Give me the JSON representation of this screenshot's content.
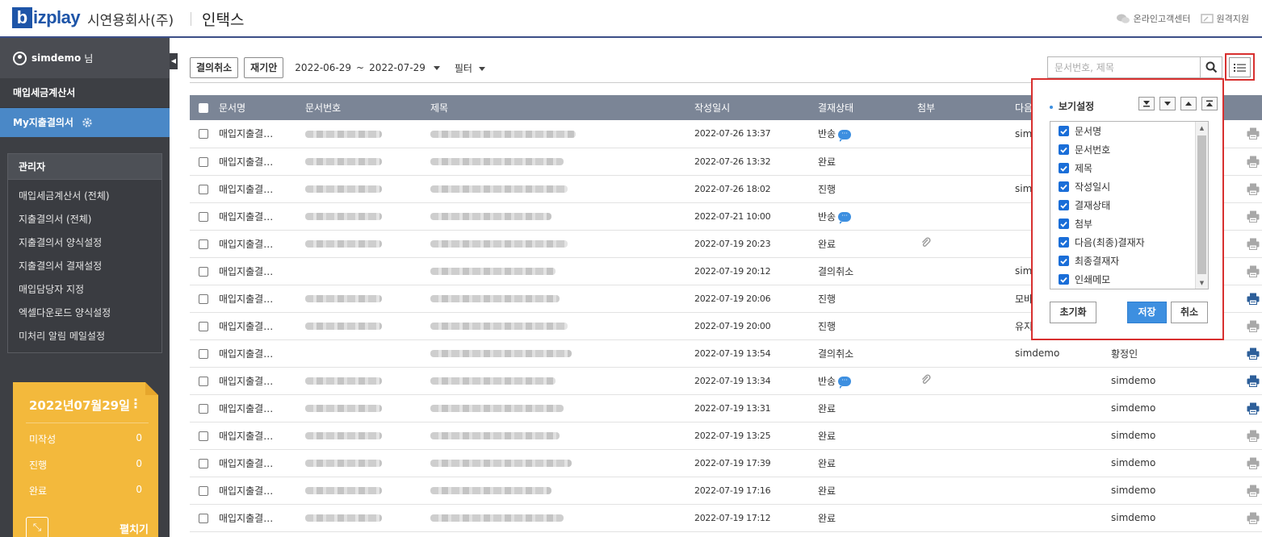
{
  "header": {
    "logo_letter": "b",
    "logo_text": "izplay",
    "company": "시연용회사(주)",
    "title": "인택스",
    "links": [
      {
        "icon": "chat-bubbles-icon",
        "label": "온라인고객센터"
      },
      {
        "icon": "remote-support-icon",
        "label": "원격지원"
      }
    ]
  },
  "sidebar": {
    "user": {
      "name": "simdemo",
      "suffix": "님"
    },
    "menu": [
      {
        "label": "매입세금계산서",
        "active": false
      },
      {
        "label": "My지출결의서",
        "active": true
      }
    ],
    "admin": {
      "title": "관리자",
      "items": [
        "매입세금계산서 (전체)",
        "지출결의서 (전체)",
        "지출결의서 양식설정",
        "지출결의서 결재설정",
        "매입담당자 지정",
        "엑셀다운로드 양식설정",
        "미처리 알림 메일설정"
      ]
    },
    "calendar": {
      "date": "2022년07월29일",
      "stats": [
        {
          "label": "미작성",
          "value": "0"
        },
        {
          "label": "진행",
          "value": "0"
        },
        {
          "label": "완료",
          "value": "0"
        }
      ],
      "expand_label": "펼치기"
    }
  },
  "toolbar": {
    "cancel_label": "결의취소",
    "redraft_label": "재기안",
    "date_from": "2022-06-29",
    "tilde": "~",
    "date_to": "2022-07-29",
    "filter_label": "필터",
    "search_placeholder": "문서번호, 제목"
  },
  "table": {
    "columns": [
      "문서명",
      "문서번호",
      "제목",
      "작성일시",
      "결재상태",
      "첨부",
      "다음"
    ],
    "rows": [
      {
        "name": "매입지출결…",
        "docno": true,
        "subject": 180,
        "date": "2022-07-26 13:37",
        "status": "반송",
        "memo": true,
        "attach": false,
        "next": "sim",
        "final": "",
        "print": "light"
      },
      {
        "name": "매입지출결…",
        "docno": true,
        "subject": 165,
        "date": "2022-07-26 13:32",
        "status": "완료",
        "memo": false,
        "attach": false,
        "next": "",
        "final": "",
        "print": "light"
      },
      {
        "name": "매입지출결…",
        "docno": true,
        "subject": 170,
        "date": "2022-07-26 18:02",
        "status": "진행",
        "memo": false,
        "attach": false,
        "next": "sim",
        "final": "",
        "print": "light"
      },
      {
        "name": "매입지출결…",
        "docno": true,
        "subject": 150,
        "date": "2022-07-21 10:00",
        "status": "반송",
        "memo": true,
        "attach": false,
        "next": "",
        "final": "",
        "print": "light"
      },
      {
        "name": "매입지출결…",
        "docno": true,
        "subject": 170,
        "date": "2022-07-19 20:23",
        "status": "완료",
        "memo": false,
        "attach": true,
        "next": "",
        "final": "",
        "print": "light"
      },
      {
        "name": "매입지출결…",
        "docno": false,
        "subject": 155,
        "date": "2022-07-19 20:12",
        "status": "결의취소",
        "memo": false,
        "attach": false,
        "next": "sim",
        "final": "",
        "print": "light"
      },
      {
        "name": "매입지출결…",
        "docno": true,
        "subject": 160,
        "date": "2022-07-19 20:06",
        "status": "진행",
        "memo": false,
        "attach": false,
        "next": "모바",
        "final": "",
        "print": "dark"
      },
      {
        "name": "매입지출결…",
        "docno": true,
        "subject": 170,
        "date": "2022-07-19 20:00",
        "status": "진행",
        "memo": false,
        "attach": false,
        "next": "유지",
        "final": "",
        "print": "light"
      },
      {
        "name": "매입지출결…",
        "docno": false,
        "subject": 175,
        "date": "2022-07-19 13:54",
        "status": "결의취소",
        "memo": false,
        "attach": false,
        "next": "simdemo",
        "final": "황정인",
        "print": "dark"
      },
      {
        "name": "매입지출결…",
        "docno": true,
        "subject": 155,
        "date": "2022-07-19 13:34",
        "status": "반송",
        "memo": true,
        "attach": true,
        "next": "",
        "final": "simdemo",
        "print": "dark"
      },
      {
        "name": "매입지출결…",
        "docno": true,
        "subject": 165,
        "date": "2022-07-19 13:31",
        "status": "완료",
        "memo": false,
        "attach": false,
        "next": "",
        "final": "simdemo",
        "print": "dark"
      },
      {
        "name": "매입지출결…",
        "docno": true,
        "subject": 160,
        "date": "2022-07-19 13:25",
        "status": "완료",
        "memo": false,
        "attach": false,
        "next": "",
        "final": "simdemo",
        "print": "light"
      },
      {
        "name": "매입지출결…",
        "docno": true,
        "subject": 175,
        "date": "2022-07-19 17:39",
        "status": "완료",
        "memo": false,
        "attach": false,
        "next": "",
        "final": "simdemo",
        "print": "light"
      },
      {
        "name": "매입지출결…",
        "docno": true,
        "subject": 150,
        "date": "2022-07-19 17:16",
        "status": "완료",
        "memo": false,
        "attach": false,
        "next": "",
        "final": "simdemo",
        "print": "light"
      },
      {
        "name": "매입지출결…",
        "docno": true,
        "subject": 165,
        "date": "2022-07-19 17:12",
        "status": "완료",
        "memo": false,
        "attach": false,
        "next": "",
        "final": "simdemo",
        "print": "light"
      }
    ]
  },
  "view_settings": {
    "title": "보기설정",
    "columns": [
      "문서명",
      "문서번호",
      "제목",
      "작성일시",
      "결재상태",
      "첨부",
      "다음(최종)결재자",
      "최종결재자",
      "인쇄메모"
    ],
    "reset_label": "초기화",
    "save_label": "저장",
    "cancel_label": "취소"
  },
  "colors": {
    "accent": "#3d8fe0",
    "sidebar": "#3d3f44",
    "header_border": "#3b4e86",
    "highlight": "#d8302f",
    "calendar": "#f3b93c"
  }
}
